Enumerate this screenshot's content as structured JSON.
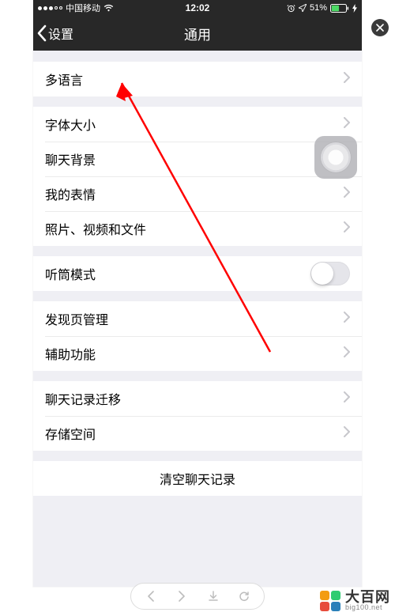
{
  "status": {
    "carrier": "中国移动",
    "time": "12:02",
    "battery": "51%"
  },
  "nav": {
    "back": "设置",
    "title": "通用"
  },
  "groups": [
    {
      "rows": [
        {
          "label": "多语言",
          "type": "disclosure"
        }
      ]
    },
    {
      "rows": [
        {
          "label": "字体大小",
          "type": "disclosure"
        },
        {
          "label": "聊天背景",
          "type": "disclosure"
        },
        {
          "label": "我的表情",
          "type": "disclosure"
        },
        {
          "label": "照片、视频和文件",
          "type": "disclosure"
        }
      ]
    },
    {
      "rows": [
        {
          "label": "听筒模式",
          "type": "switch",
          "on": false
        }
      ]
    },
    {
      "rows": [
        {
          "label": "发现页管理",
          "type": "disclosure"
        },
        {
          "label": "辅助功能",
          "type": "disclosure"
        }
      ]
    },
    {
      "rows": [
        {
          "label": "聊天记录迁移",
          "type": "disclosure"
        },
        {
          "label": "存储空间",
          "type": "disclosure"
        }
      ]
    },
    {
      "rows": [
        {
          "label": "清空聊天记录",
          "type": "center"
        }
      ]
    }
  ],
  "watermark": {
    "name": "大百网",
    "url": "big100.net"
  }
}
